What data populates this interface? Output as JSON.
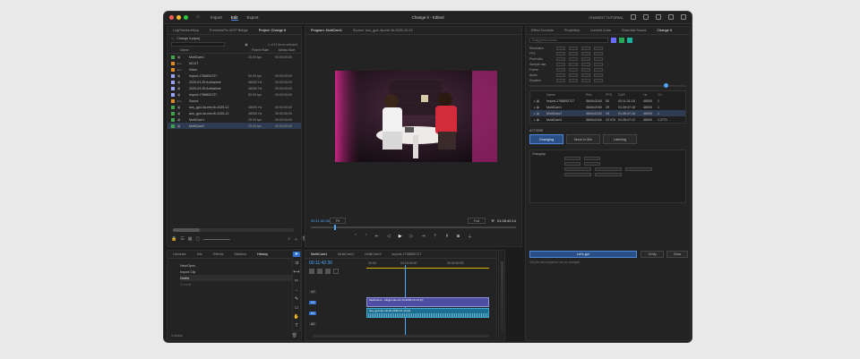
{
  "window": {
    "title": "Change it - Edited",
    "workspace_tabs": [
      "Import",
      "Edit",
      "Export"
    ],
    "active_tab": "Edit",
    "right_label": "CHANGIT TUTORIAL"
  },
  "project_panel": {
    "tabs": [
      "LegPremiereMcp",
      "PremierePro MCP Bridge",
      "Project: Change It"
    ],
    "path": "Change it.prproj",
    "selected_info": "1 of 12 items selected",
    "columns": [
      "Name",
      "Frame Rate",
      "Media Start"
    ],
    "items": [
      {
        "name": "MultiCam1",
        "rate": "25.00 fps",
        "start": "00:00:00:00",
        "color": "#3fa34d"
      },
      {
        "name": "MCUT",
        "rate": "",
        "start": "",
        "color": "#e08a1e"
      },
      {
        "name": "Video",
        "rate": "",
        "start": "",
        "color": "#e08a1e"
      },
      {
        "name": "import-1798893727",
        "rate": "50.00 fps",
        "start": "00:00:00:00",
        "color": "#9aa1ff"
      },
      {
        "name": "2025-03-25 Aufnahme",
        "rate": "48000 Hz",
        "start": "00:00:00:00",
        "color": "#9aa1ff"
      },
      {
        "name": "2025-03-25 Aufnahme",
        "rate": "48000 Hz",
        "start": "00:00:00:00",
        "color": "#9aa1ff"
      },
      {
        "name": "import-1798893727",
        "rate": "50.00 fps",
        "start": "00:00:00:00",
        "color": "#9aa1ff"
      },
      {
        "name": "Sound",
        "rate": "",
        "start": "",
        "color": "#e08a1e"
      },
      {
        "name": "aus_gp4-4a-min-fb-2025-12",
        "rate": "48000 Hz",
        "start": "00:00:00:00",
        "color": "#3fa34d"
      },
      {
        "name": "aus_gp4-4a-min-fb-2025-12",
        "rate": "48000 Hz",
        "start": "00:00:00:00",
        "color": "#3fa34d"
      },
      {
        "name": "MultiCam1",
        "rate": "25.00 fps",
        "start": "00:00:00:00",
        "color": "#3fa34d"
      },
      {
        "name": "MultiCam2",
        "rate": "25.00 fps",
        "start": "00:00:00:00",
        "color": "#3fa34d"
      }
    ]
  },
  "history_panel": {
    "tabs": [
      "Libraries",
      "Info",
      "Effects",
      "Markers",
      "History"
    ],
    "items": [
      "New/Open",
      "Import Clip",
      "Delete",
      "Commit"
    ],
    "footer": "3 Undos"
  },
  "program_monitor": {
    "tabs": [
      "Program: MultiCam1",
      "Source: aus_gp4-4a-min-fb-2025-12-13"
    ],
    "timecode_left": "00:11:42:36",
    "fit": "Fit",
    "quality": "Full",
    "timecode_right": "01:28:42:14"
  },
  "timeline": {
    "tabs": [
      "MultiCam1",
      "MultiCam2",
      "MultiCam3",
      "import-1798893727"
    ],
    "timecode": "00:11:42:36",
    "ruler_marks": [
      "00:00",
      "00:15:00:00",
      "00:30:00:00"
    ],
    "tracks": [
      "V2",
      "V1",
      "A1",
      "A2"
    ],
    "clip_v1": "MultiCam1 - fullgp4-4a-min-fb-2025-12-13 [V]",
    "clip_a1": "aus_gp4-4a-min-fb-2025-12-13 [A]"
  },
  "right_panel": {
    "tabs": [
      "Effect Controls",
      "Properties",
      "Lumetri Color",
      "Essential Sound",
      "Change It"
    ],
    "search_placeholder": "Drag person icons...",
    "props": [
      "Resolution",
      "FPS",
      "Pixel ratio",
      "Sample rate",
      "Frame",
      "Audio",
      "Duration"
    ],
    "table_header": [
      "Name",
      "Res",
      "FPS",
      "DUR",
      "Hz",
      "Ch"
    ],
    "table_rows": [
      {
        "name": "import-1798893727",
        "res": "3840x2160",
        "fps": "50",
        "dur": "00:11:31:18",
        "hz": "48000",
        "ch": "1"
      },
      {
        "name": "MultiCam1",
        "res": "3840x2160",
        "fps": "25",
        "dur": "01:28:47:16",
        "hz": "48000",
        "ch": "1"
      },
      {
        "name": "MultiCam2",
        "res": "3840x2160",
        "fps": "25",
        "dur": "01:28:47:16",
        "hz": "48000",
        "ch": "1"
      },
      {
        "name": "MultiCam3",
        "res": "3840x2160",
        "fps": "23.976",
        "dur": "01:28:47:12",
        "hz": "48000",
        "ch": "1.2771"
      }
    ],
    "actions_label": "ACTIONS",
    "action_buttons": [
      "Changing",
      "Move to Bin",
      "Labeling"
    ],
    "changing_label": "Changing",
    "apply_label": "Let's go!",
    "cancel_label": "Verify",
    "clear_label": "Clear",
    "hint": "Only the last sequence can be changed..."
  }
}
